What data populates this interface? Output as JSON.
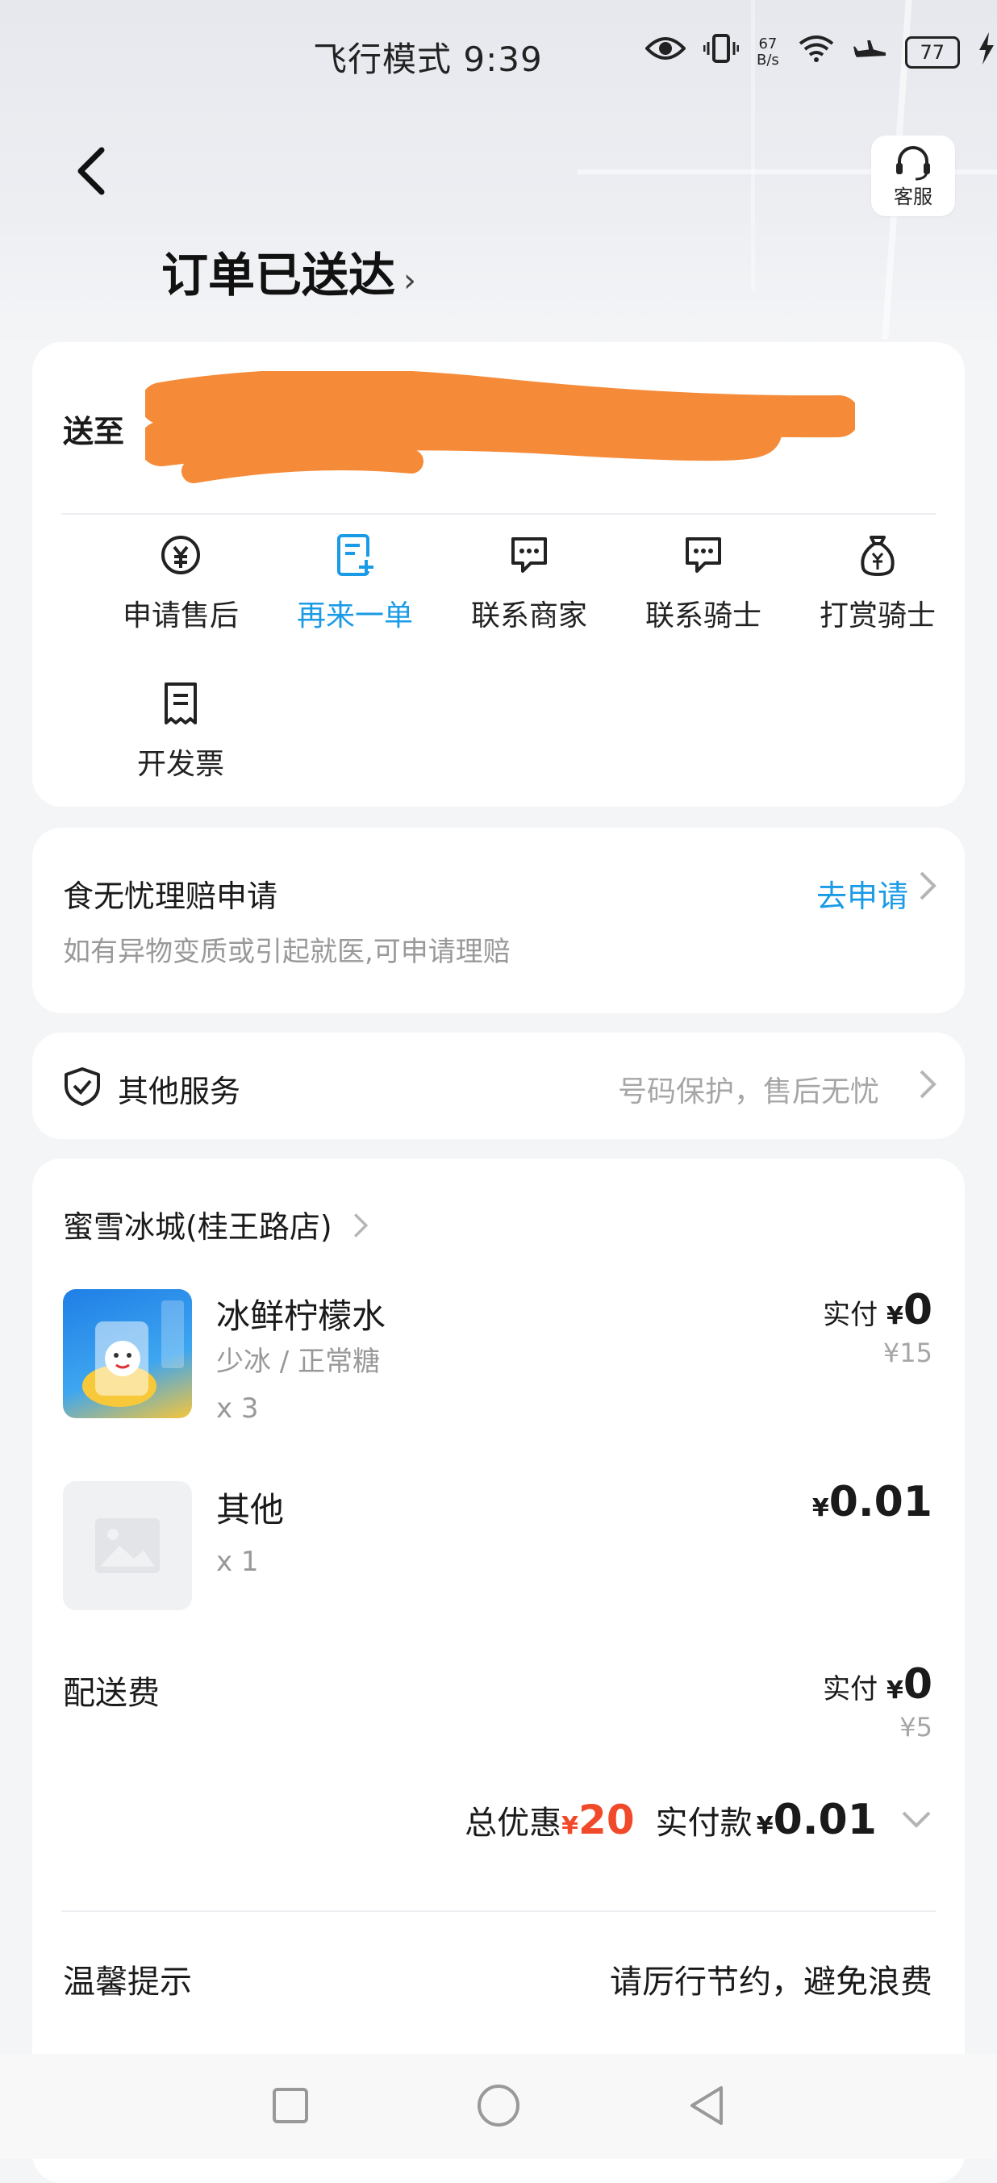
{
  "status_bar": {
    "left_text": "飞行模式 9:39",
    "net_speed_value": "67",
    "net_speed_unit": "B/s",
    "battery": "77"
  },
  "header": {
    "service_label": "客服",
    "title": "订单已送达",
    "title_chevron": "›"
  },
  "delivery": {
    "to_label": "送至"
  },
  "actions": [
    {
      "label": "申请售后",
      "icon": "yuan-refresh-icon"
    },
    {
      "label": "再来一单",
      "icon": "reorder-doc-icon"
    },
    {
      "label": "联系商家",
      "icon": "chat-bubble-icon"
    },
    {
      "label": "联系骑士",
      "icon": "chat-bubble-icon"
    },
    {
      "label": "打赏骑士",
      "icon": "money-bag-icon"
    },
    {
      "label": "开发票",
      "icon": "receipt-icon"
    }
  ],
  "claim": {
    "title": "食无忧理赔申请",
    "description": "如有异物变质或引起就医,可申请理赔",
    "link": "去申请"
  },
  "other_services": {
    "title": "其他服务",
    "description": "号码保护，售后无忧"
  },
  "order": {
    "shop_name": "蜜雪冰城(桂王路店)",
    "items": [
      {
        "name": "冰鲜柠檬水",
        "spec": "少冰 / 正常糖",
        "qty": "x 3",
        "paid_label": "实付",
        "currency": "¥",
        "paid": "0",
        "original": "¥15"
      },
      {
        "name": "其他",
        "qty": "x 1",
        "currency": "¥",
        "paid": "0.01"
      }
    ],
    "delivery_fee": {
      "label": "配送费",
      "paid_label": "实付",
      "currency": "¥",
      "paid": "0",
      "original": "¥5"
    },
    "totals": {
      "discount_label": "总优惠",
      "discount_currency": "¥",
      "discount": "20",
      "paid_label": "实付款",
      "paid_currency": "¥",
      "paid": "0.01"
    },
    "tip": {
      "label": "温馨提示",
      "text": "请厉行节约，避免浪费"
    }
  },
  "colors": {
    "accent": "#1a9be6",
    "discount": "#f04a2a",
    "redaction": "#f58a38"
  }
}
